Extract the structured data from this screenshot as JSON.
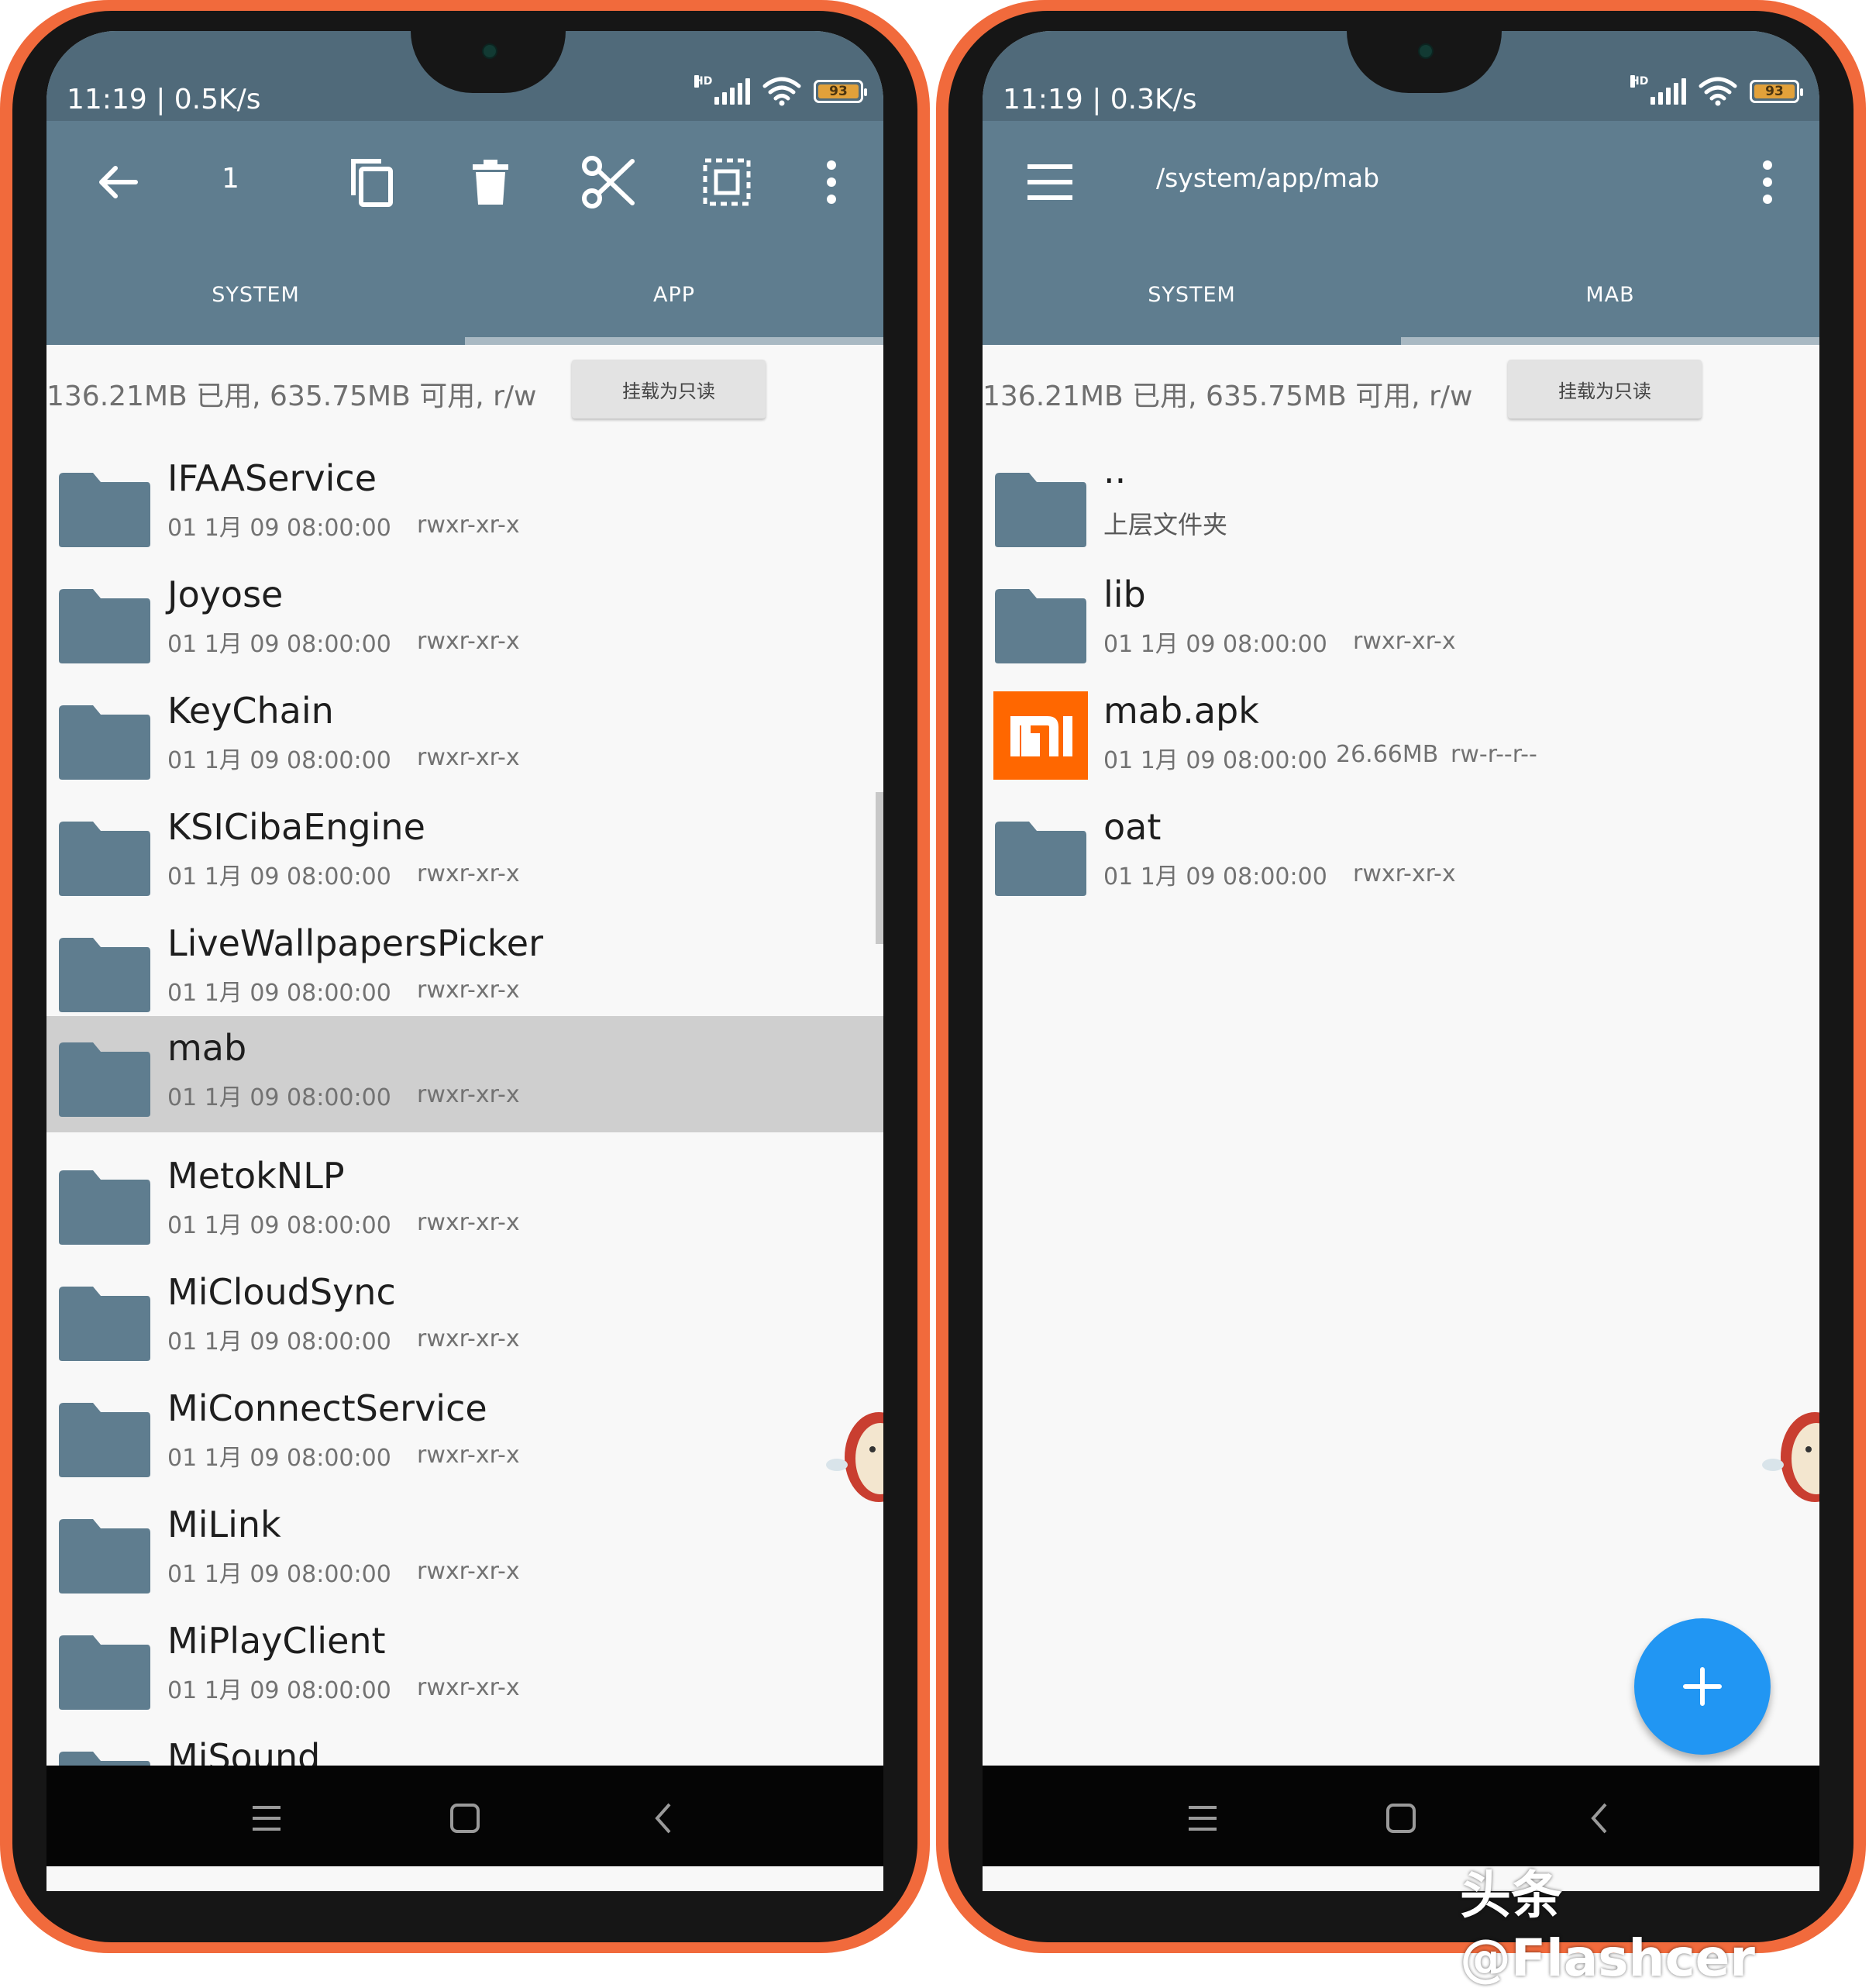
{
  "colors": {
    "phone_frame": "#f16a3c",
    "app_bar": "#5f7d8f",
    "status_bar": "#506a7a",
    "folder_icon": "#5f7d8f",
    "fab": "#2196f3",
    "mi_logo": "#ff6700",
    "selected_row": "#cfcfcf"
  },
  "left_phone": {
    "status": {
      "time": "11:19",
      "speed": "0.5K/s",
      "network_badge": "HD",
      "battery": "93"
    },
    "toolbar": {
      "selected_count": "1",
      "icons": [
        "back-arrow-icon",
        "copy-icon",
        "delete-icon",
        "cut-icon",
        "select-all-icon",
        "more-vert-icon"
      ]
    },
    "tabs": [
      {
        "label": "SYSTEM",
        "active": false
      },
      {
        "label": "APP",
        "active": true
      }
    ],
    "storage": {
      "text": "136.21MB 已用, 635.75MB 可用, r/w",
      "mount_label": "挂载为只读"
    },
    "files": [
      {
        "name": "IFAAService",
        "date": "01 1月 09 08:00:00",
        "perm": "rwxr-xr-x",
        "selected": false
      },
      {
        "name": "Joyose",
        "date": "01 1月 09 08:00:00",
        "perm": "rwxr-xr-x",
        "selected": false
      },
      {
        "name": "KeyChain",
        "date": "01 1月 09 08:00:00",
        "perm": "rwxr-xr-x",
        "selected": false
      },
      {
        "name": "KSICibaEngine",
        "date": "01 1月 09 08:00:00",
        "perm": "rwxr-xr-x",
        "selected": false
      },
      {
        "name": "LiveWallpapersPicker",
        "date": "01 1月 09 08:00:00",
        "perm": "rwxr-xr-x",
        "selected": false
      },
      {
        "name": "mab",
        "date": "01 1月 09 08:00:00",
        "perm": "rwxr-xr-x",
        "selected": true
      },
      {
        "name": "MetokNLP",
        "date": "01 1月 09 08:00:00",
        "perm": "rwxr-xr-x",
        "selected": false
      },
      {
        "name": "MiCloudSync",
        "date": "01 1月 09 08:00:00",
        "perm": "rwxr-xr-x",
        "selected": false
      },
      {
        "name": "MiConnectService",
        "date": "01 1月 09 08:00:00",
        "perm": "rwxr-xr-x",
        "selected": false
      },
      {
        "name": "MiLink",
        "date": "01 1月 09 08:00:00",
        "perm": "rwxr-xr-x",
        "selected": false
      },
      {
        "name": "MiPlayClient",
        "date": "01 1月 09 08:00:00",
        "perm": "rwxr-xr-x",
        "selected": false
      },
      {
        "name": "MiSound",
        "date": "",
        "perm": "",
        "selected": false
      }
    ]
  },
  "right_phone": {
    "status": {
      "time": "11:19",
      "speed": "0.3K/s",
      "network_badge": "HD",
      "battery": "93"
    },
    "toolbar": {
      "path": "/system/app/mab",
      "icons": [
        "menu-icon",
        "more-vert-icon"
      ]
    },
    "tabs": [
      {
        "label": "SYSTEM",
        "active": false
      },
      {
        "label": "MAB",
        "active": true
      }
    ],
    "storage": {
      "text": "136.21MB 已用, 635.75MB 可用, r/w",
      "mount_label": "挂载为只读"
    },
    "files": [
      {
        "name": "..",
        "date": "上层文件夹",
        "perm": "",
        "type": "parent"
      },
      {
        "name": "lib",
        "date": "01 1月 09 08:00:00",
        "perm": "rwxr-xr-x",
        "type": "folder"
      },
      {
        "name": "mab.apk",
        "date": "01 1月 09 08:00:00",
        "size": "26.66MB",
        "perm": "rw-r--r--",
        "type": "apk"
      },
      {
        "name": "oat",
        "date": "01 1月 09 08:00:00",
        "perm": "rwxr-xr-x",
        "type": "folder"
      }
    ],
    "fab_icon": "plus-icon"
  },
  "navbar_icons": [
    "menu-nav-icon",
    "home-nav-icon",
    "back-nav-icon"
  ],
  "watermark": "头条 @Flashcer"
}
